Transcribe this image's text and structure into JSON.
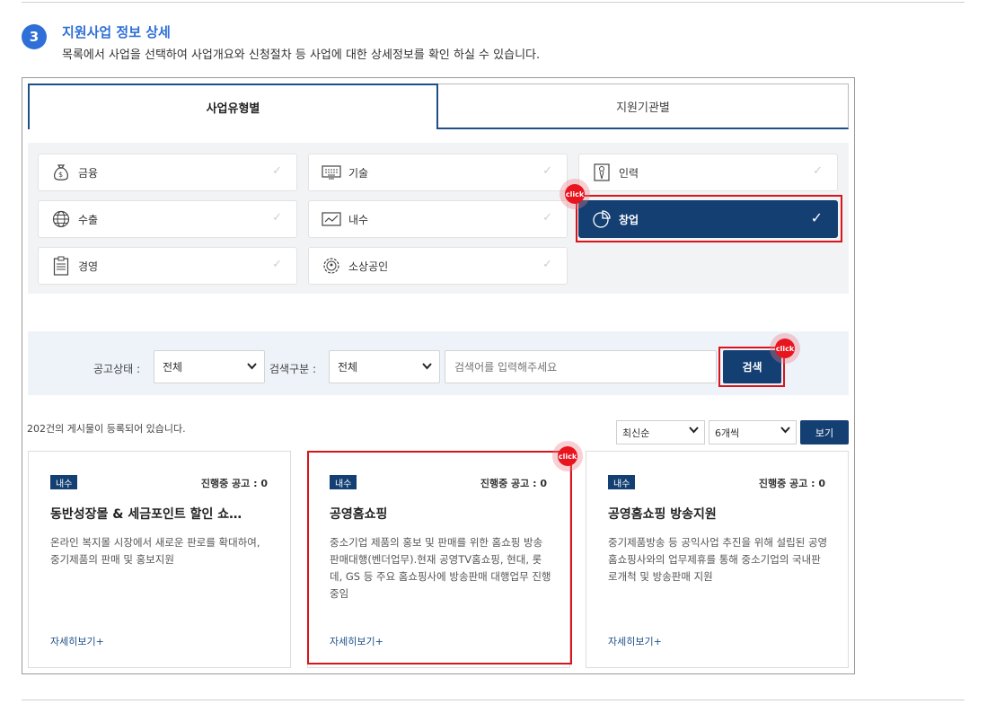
{
  "step": {
    "number": "3",
    "title": "지원사업 정보 상세",
    "description": "목록에서 사업을 선택하여 사업개요와 신청절차 등 사업에 대한 상세정보를 확인 하실 수 있습니다."
  },
  "tabs": [
    {
      "label": "사업유형별",
      "active": true
    },
    {
      "label": "지원기관별",
      "active": false
    }
  ],
  "categories": [
    {
      "label": "금융",
      "icon": "money-bag-icon"
    },
    {
      "label": "기술",
      "icon": "keyboard-icon"
    },
    {
      "label": "인력",
      "icon": "person-icon"
    },
    {
      "label": "수출",
      "icon": "globe-icon"
    },
    {
      "label": "내수",
      "icon": "chart-icon"
    },
    {
      "label": "창업",
      "icon": "pie-chart-icon",
      "selected": true
    },
    {
      "label": "경영",
      "icon": "clipboard-icon"
    },
    {
      "label": "소상공인",
      "icon": "gear-people-icon"
    }
  ],
  "check_glyph": "✓",
  "click_label": "click",
  "search": {
    "status_label": "공고상태 :",
    "status_value": "전체",
    "type_label": "검색구분 :",
    "type_value": "전체",
    "placeholder": "검색어를 입력해주세요",
    "button": "검색"
  },
  "list": {
    "count_text": "202건의 게시물이 등록되어 있습니다.",
    "sort_value": "최신순",
    "per_page_value": "6개씩",
    "view_button": "보기"
  },
  "cards": [
    {
      "badge": "내수",
      "status": "진행중 공고 : 0",
      "title": "동반성장몰 & 세금포인트 할인 쇼…",
      "desc": "온라인 복지몰 시장에서 새로운 판로를 확대하여, 중기제품의 판매 및 홍보지원",
      "more": "자세히보기+"
    },
    {
      "badge": "내수",
      "status": "진행중 공고 : 0",
      "title": "공영홈쇼핑",
      "desc": "중소기업 제품의 홍보 및 판매를 위한 홈쇼핑 방송 판매대행(벤더업무).현재 공영TV홈쇼핑, 현대, 롯데, GS 등 주요 홈쇼핑사에 방송판매 대행업무 진행중임",
      "more": "자세히보기+"
    },
    {
      "badge": "내수",
      "status": "진행중 공고 : 0",
      "title": "공영홈쇼핑 방송지원",
      "desc": "중기제품방송 등 공익사업 추진을 위해 설립된 공영홈쇼핑사와의 업무제휴를 통해 중소기업의 국내판로개척 및 방송판매 지원",
      "more": "자세히보기+"
    }
  ],
  "colors": {
    "accent": "#2f6fd8",
    "navy": "#143f73",
    "highlight": "#d9141a"
  }
}
